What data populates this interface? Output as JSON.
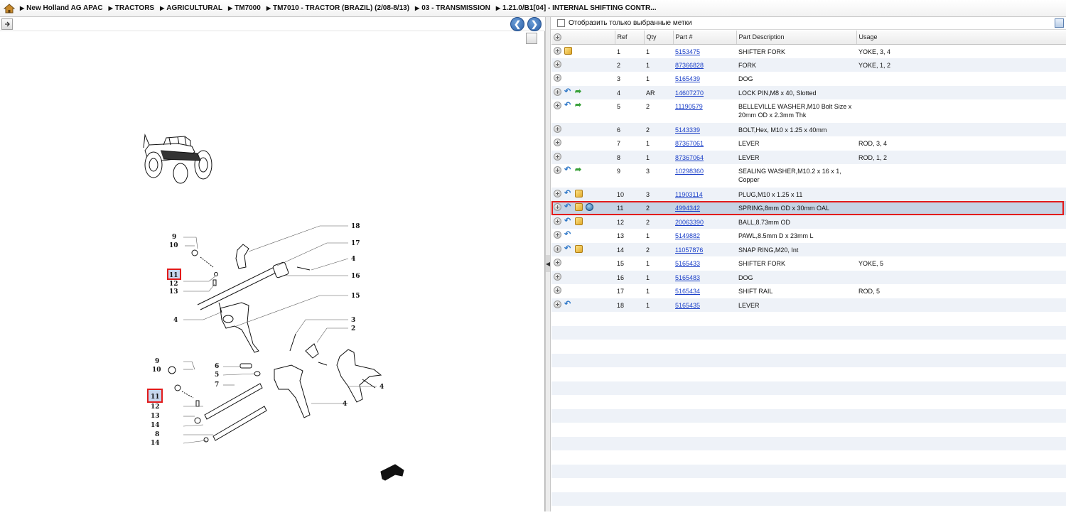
{
  "breadcrumb": [
    "New Holland AG APAC",
    "TRACTORS",
    "AGRICULTURAL",
    "TM7000",
    "TM7010 - TRACTOR (BRAZIL) (2/08-8/13)",
    "03 - TRANSMISSION",
    "1.21.0/B1[04] - INTERNAL SHIFTING CONTR..."
  ],
  "filter": {
    "label": "Отобразить только выбранные метки",
    "checked": false
  },
  "table": {
    "headers": {
      "ref": "Ref",
      "qty": "Qty",
      "part": "Part #",
      "desc": "Part Description",
      "usage": "Usage"
    },
    "rows": [
      {
        "ref": "1",
        "qty": "1",
        "part": "5153475",
        "desc": "SHIFTER FORK",
        "usage": "YOKE, 3, 4",
        "icons": [
          "plus-icon",
          "package-icon"
        ]
      },
      {
        "ref": "2",
        "qty": "1",
        "part": "87366828",
        "desc": "FORK",
        "usage": "YOKE, 1, 2",
        "icons": [
          "plus-icon"
        ]
      },
      {
        "ref": "3",
        "qty": "1",
        "part": "5165439",
        "desc": "DOG",
        "usage": "",
        "icons": [
          "plus-icon"
        ]
      },
      {
        "ref": "4",
        "qty": "AR",
        "part": "14607270",
        "desc": "LOCK PIN,M8 x 40, Slotted",
        "usage": "",
        "icons": [
          "plus-icon",
          "back-arrow-icon",
          "forward-arrow-icon"
        ]
      },
      {
        "ref": "5",
        "qty": "2",
        "part": "11190579",
        "desc": "BELLEVILLE WASHER,M10 Bolt Size x",
        "desc2": "20mm OD x 2.3mm Thk",
        "usage": "",
        "icons": [
          "plus-icon",
          "back-arrow-icon",
          "forward-arrow-icon"
        ]
      },
      {
        "ref": "6",
        "qty": "2",
        "part": "5143339",
        "desc": "BOLT,Hex, M10 x 1.25 x 40mm",
        "usage": "",
        "icons": [
          "plus-icon"
        ]
      },
      {
        "ref": "7",
        "qty": "1",
        "part": "87367061",
        "desc": "LEVER",
        "usage": "ROD, 3, 4",
        "icons": [
          "plus-icon"
        ]
      },
      {
        "ref": "8",
        "qty": "1",
        "part": "87367064",
        "desc": "LEVER",
        "usage": "ROD, 1, 2",
        "icons": [
          "plus-icon"
        ]
      },
      {
        "ref": "9",
        "qty": "3",
        "part": "10298360",
        "desc": "SEALING WASHER,M10.2 x 16 x 1,",
        "desc2": "Copper",
        "usage": "",
        "icons": [
          "plus-icon",
          "back-arrow-icon",
          "forward-arrow-icon"
        ]
      },
      {
        "ref": "10",
        "qty": "3",
        "part": "11903114",
        "desc": "PLUG,M10 x 1.25 x 11",
        "usage": "",
        "icons": [
          "plus-icon",
          "back-arrow-icon",
          "package-icon"
        ]
      },
      {
        "ref": "11",
        "qty": "2",
        "part": "4994342",
        "desc": "SPRING,8mm OD x 30mm OAL",
        "usage": "",
        "icons": [
          "plus-icon",
          "back-arrow-icon",
          "package-icon",
          "globe-icon"
        ],
        "selected": true
      },
      {
        "ref": "12",
        "qty": "2",
        "part": "20063390",
        "desc": "BALL,8.73mm OD",
        "usage": "",
        "icons": [
          "plus-icon",
          "back-arrow-icon",
          "package-icon"
        ]
      },
      {
        "ref": "13",
        "qty": "1",
        "part": "5149882",
        "desc": "PAWL,8.5mm D x 23mm L",
        "usage": "",
        "icons": [
          "plus-icon",
          "back-arrow-icon"
        ]
      },
      {
        "ref": "14",
        "qty": "2",
        "part": "11057876",
        "desc": "SNAP RING,M20, Int",
        "usage": "",
        "icons": [
          "plus-icon",
          "back-arrow-icon",
          "package-icon"
        ]
      },
      {
        "ref": "15",
        "qty": "1",
        "part": "5165433",
        "desc": "SHIFTER FORK",
        "usage": "YOKE, 5",
        "icons": [
          "plus-icon"
        ]
      },
      {
        "ref": "16",
        "qty": "1",
        "part": "5165483",
        "desc": "DOG",
        "usage": "",
        "icons": [
          "plus-icon"
        ]
      },
      {
        "ref": "17",
        "qty": "1",
        "part": "5165434",
        "desc": "SHIFT RAIL",
        "usage": "ROD, 5",
        "icons": [
          "plus-icon"
        ]
      },
      {
        "ref": "18",
        "qty": "1",
        "part": "5165435",
        "desc": "LEVER",
        "usage": "",
        "icons": [
          "plus-icon",
          "back-arrow-icon"
        ]
      }
    ]
  },
  "diagram": {
    "callouts_upper": [
      "9",
      "10",
      "11",
      "12",
      "13",
      "4",
      "18",
      "17",
      "4",
      "16",
      "15"
    ],
    "callouts_lower": [
      "9",
      "10",
      "11",
      "12",
      "13",
      "14",
      "8",
      "14",
      "6",
      "5",
      "7",
      "3",
      "2",
      "4",
      "4"
    ],
    "highlighted_ref": "11"
  },
  "colors": {
    "link": "#1a3fc8",
    "selection": "#c6d3e4",
    "highlight_border": "#e21b1b",
    "zebra": "#eef2f8"
  }
}
